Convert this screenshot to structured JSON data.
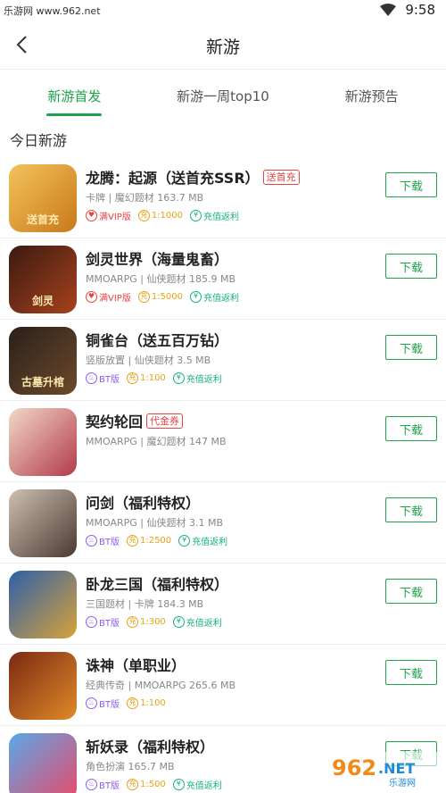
{
  "status_bar": {
    "watermark": "乐游网 www.962.net",
    "time": "9:58"
  },
  "header": {
    "title": "新游"
  },
  "tabs": [
    {
      "label": "新游首发",
      "active": true
    },
    {
      "label": "新游一周top10",
      "active": false
    },
    {
      "label": "新游预告",
      "active": false
    }
  ],
  "section_title": "今日新游",
  "download_label": "下载",
  "games": [
    {
      "name": "龙腾：起源（送首充SSR）",
      "tag": "送首充",
      "meta": "卡牌 | 魔幻题材 163.7 MB",
      "badges": [
        {
          "type": "vip",
          "text": "满VIP版"
        },
        {
          "type": "rate",
          "text": "1:1000"
        },
        {
          "type": "rebate",
          "text": "充值返利"
        }
      ],
      "icon": "dragon-game-icon",
      "icon_text": "送首充",
      "colors": [
        "#f3c25a",
        "#c9791a"
      ]
    },
    {
      "name": "剑灵世界（海量鬼畜）",
      "tag": "",
      "meta": "MMOARPG | 仙侠题材 185.9 MB",
      "badges": [
        {
          "type": "vip",
          "text": "满VIP版"
        },
        {
          "type": "rate",
          "text": "1:5000"
        },
        {
          "type": "rebate",
          "text": "充值返利"
        }
      ],
      "icon": "sword-spirit-game-icon",
      "icon_text": "剑灵",
      "colors": [
        "#3a1a12",
        "#a8421c"
      ]
    },
    {
      "name": "铜雀台（送五百万钻）",
      "tag": "",
      "meta": "竖版放置 | 仙侠题材 3.5 MB",
      "badges": [
        {
          "type": "bt",
          "text": "BT版"
        },
        {
          "type": "rate",
          "text": "1:100"
        },
        {
          "type": "rebate",
          "text": "充值返利"
        }
      ],
      "icon": "bronze-tower-game-icon",
      "icon_text": "古墓升棺",
      "colors": [
        "#2a1f1a",
        "#6b4a2a"
      ]
    },
    {
      "name": "契约轮回",
      "tag": "代金券",
      "meta": "MMOARPG | 魔幻题材 147 MB",
      "badges": [],
      "icon": "contract-cycle-game-icon",
      "icon_text": "",
      "colors": [
        "#f2d9c7",
        "#b23a4a"
      ]
    },
    {
      "name": "问剑（福利特权）",
      "tag": "",
      "meta": "MMOARPG | 仙侠题材 3.1 MB",
      "badges": [
        {
          "type": "bt",
          "text": "BT版"
        },
        {
          "type": "rate",
          "text": "1:2500"
        },
        {
          "type": "rebate",
          "text": "充值返利"
        }
      ],
      "icon": "ask-sword-game-icon",
      "icon_text": "",
      "colors": [
        "#cdbfb2",
        "#4a3a32"
      ]
    },
    {
      "name": "卧龙三国（福利特权）",
      "tag": "",
      "meta": "三国题材 | 卡牌 184.3 MB",
      "badges": [
        {
          "type": "bt",
          "text": "BT版"
        },
        {
          "type": "rate",
          "text": "1:300"
        },
        {
          "type": "rebate",
          "text": "充值返利"
        }
      ],
      "icon": "wolong-game-icon",
      "icon_text": "",
      "colors": [
        "#2e5fa8",
        "#d9a23a"
      ]
    },
    {
      "name": "诛神（单职业）",
      "tag": "",
      "meta": "经典传奇 | MMOARPG 265.6 MB",
      "badges": [
        {
          "type": "bt",
          "text": "BT版"
        },
        {
          "type": "rate",
          "text": "1:100"
        }
      ],
      "icon": "zhushen-game-icon",
      "icon_text": "",
      "colors": [
        "#7a2a12",
        "#e08a2a"
      ]
    },
    {
      "name": "斩妖录（福利特权）",
      "tag": "",
      "meta": "角色扮演 165.7 MB",
      "badges": [
        {
          "type": "bt",
          "text": "BT版"
        },
        {
          "type": "rate",
          "text": "1:500"
        },
        {
          "type": "rebate",
          "text": "充值返利"
        }
      ],
      "icon": "zhanyao-game-icon",
      "icon_text": "",
      "colors": [
        "#5aa8e8",
        "#e84a6a"
      ]
    }
  ],
  "watermark_logo": {
    "main": "962.NET",
    "sub": "乐游网"
  },
  "accent_color": "#1fa34b"
}
